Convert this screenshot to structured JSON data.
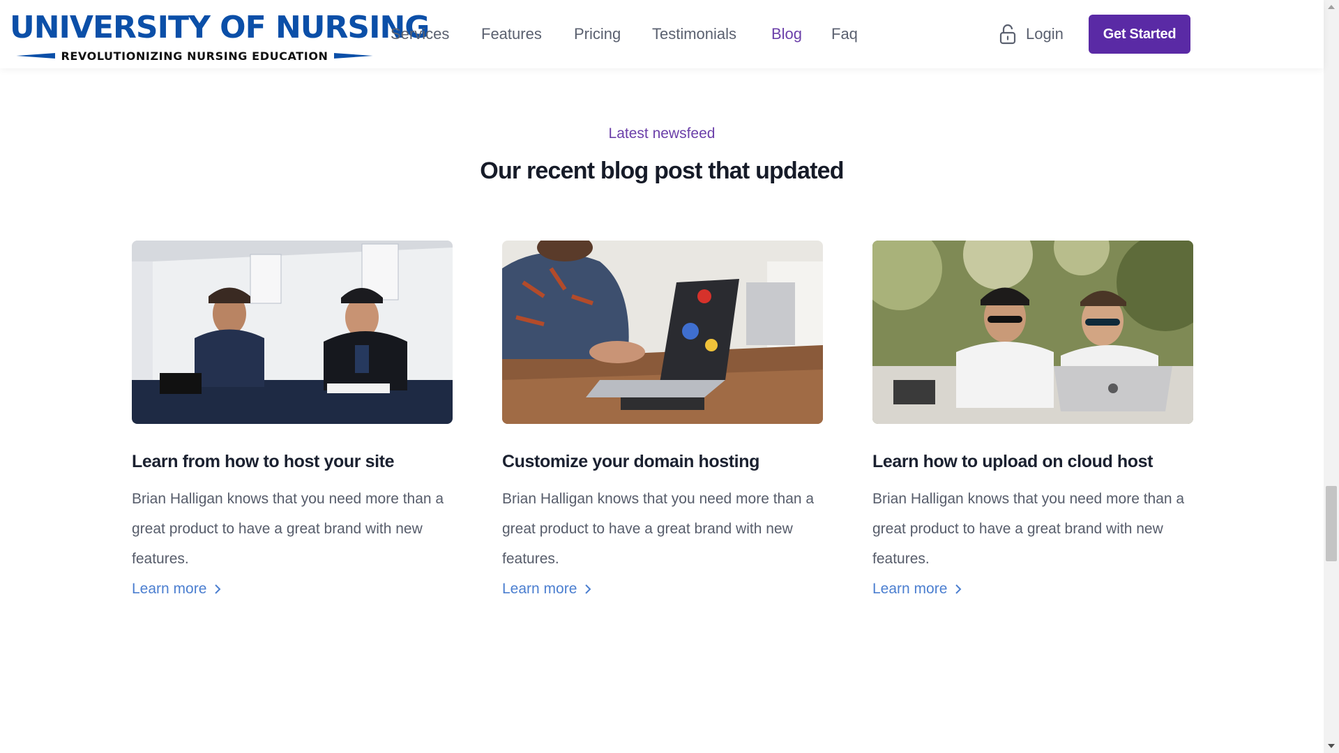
{
  "header": {
    "logo_title": "UNIVERSITY OF NURSING",
    "logo_subtitle": "REVOLUTIONIZING NURSING EDUCATION",
    "nav": [
      {
        "label": "Services"
      },
      {
        "label": "Features"
      },
      {
        "label": "Pricing"
      },
      {
        "label": "Testimonials"
      },
      {
        "label": "Blog",
        "active": true
      },
      {
        "label": "Faq"
      }
    ],
    "login_label": "Login",
    "login_icon": "lock-icon",
    "cta_label": "Get Started"
  },
  "section": {
    "eyebrow": "Latest newsfeed",
    "title": "Our recent blog post that updated"
  },
  "posts": [
    {
      "title": "Learn from how to host your site",
      "excerpt": "Brian Halligan knows that you need more than a great product to have a great brand with new features.",
      "link_label": "Learn more",
      "image": "two-men-at-table-photo"
    },
    {
      "title": "Customize your domain hosting",
      "excerpt": "Brian Halligan knows that you need more than a great product to have a great brand with new features.",
      "link_label": "Learn more",
      "image": "person-with-laptop-photo"
    },
    {
      "title": "Learn how to upload on cloud host",
      "excerpt": "Brian Halligan knows that you need more than a great product to have a great brand with new features.",
      "link_label": "Learn more",
      "image": "two-men-with-sunglasses-laptop-photo"
    }
  ],
  "colors": {
    "brand_blue": "#0b4fa8",
    "accent_purple": "#5a2aa5",
    "link_blue": "#4c7fd0"
  }
}
